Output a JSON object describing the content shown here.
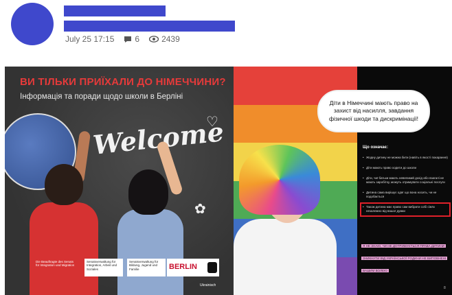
{
  "post": {
    "date": "July 25 17:15",
    "comments": "6",
    "views": "2439"
  },
  "slide1": {
    "title": "ВИ ТІЛЬКИ ПРИЇХАЛИ ДО НІМЕЧЧИНИ?",
    "subtitle": "Інформація та поради щодо школи в Берліні",
    "welcome": "Welcome",
    "footer": {
      "org1": "Die Beauftragte des Senats für Integration und Migration",
      "org2": "Senatsverwaltung für Integration, Arbeit und Soziales",
      "org3": "Senatsverwaltung für Bildung, Jugend und Familie",
      "berlin": "BERLIN",
      "language": "Ukrainisch"
    }
  },
  "slide2": {
    "bubble": "Діти в Німеччині мають право на захист від насилля, завдання фізичної шкоди та дискримінації!",
    "what_title": "Що означає:",
    "bullets": [
      "Жодну дитину не можна бити (навіть в якості покарання)",
      "Діти мають право ходити до школи",
      "Діти, чиї батьки мають невеликий дохід або взагалі не мають заробітку, можуть отримувати соціальні послуги",
      "Дитина сама вирішує одяг що вона носить, чи не подобається",
      "Також дитина має право сам вибрати собі сім'ю незалежно від вашої думки"
    ],
    "pink_note": "Я НЕ ЗНАЮ, ЧИ НЕ ДОТРИМУЄТЬСЯ ПРАВА ДИТИНИ ЗНИКНУТИ ВІД УКРАЇНСЬКОЇ РОДИНИ НЕ ВИПОВНЕНІ ВАШИМ ВОЛЕЮ",
    "page": "8"
  }
}
